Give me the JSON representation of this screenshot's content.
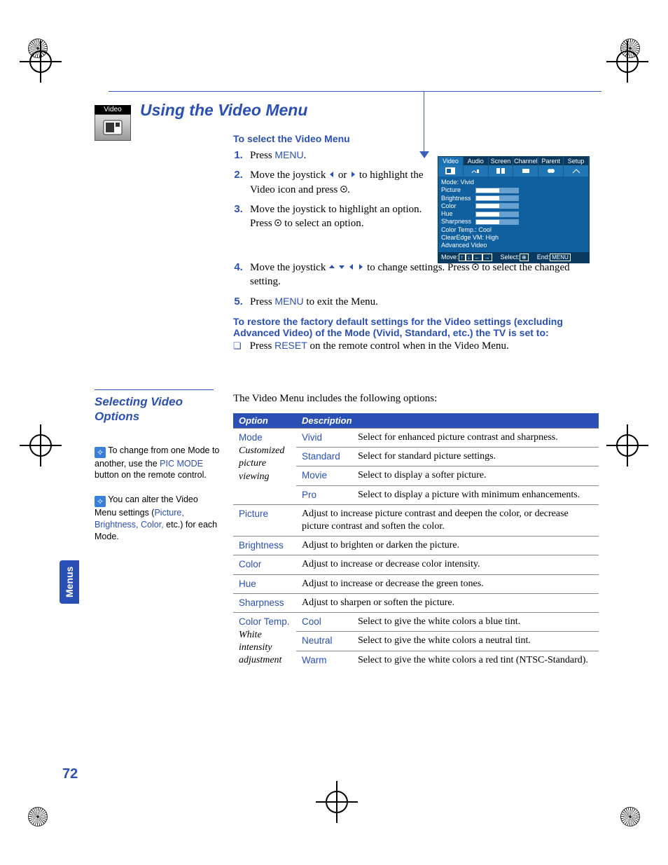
{
  "page_number": "72",
  "side_tab": "Menus",
  "icon_label": "Video",
  "title": "Using the Video Menu",
  "select_heading": "To select the Video Menu",
  "steps": {
    "s1a": "Press ",
    "s1b": "MENU",
    "s1c": ".",
    "s2a": "Move the joystick ",
    "s2b": " or ",
    "s2c": " to highlight the Video icon and press ",
    "s2d": ".",
    "s3a": "Move the joystick to highlight an option. Press ",
    "s3b": " to select an option.",
    "s4a": "Move the joystick ",
    "s4b": " to change settings. Press ",
    "s4c": " to select the changed setting.",
    "s5a": "Press ",
    "s5b": "MENU",
    "s5c": " to exit the Menu."
  },
  "restore_heading": "To restore the factory default settings for the Video settings (excluding Advanced Video) of the Mode (Vivid, Standard, etc.) the TV is set to:",
  "restore_a": "Press ",
  "restore_b": "RESET",
  "restore_c": " on the remote control when in the Video Menu.",
  "section2_title": "Selecting Video Options",
  "intro": "The Video Menu includes the following options:",
  "tips": {
    "t1a": " To change from one Mode to another, use the ",
    "t1b": "PIC MODE",
    "t1c": " button on the remote control.",
    "t2a": " You can alter the Video Menu settings (",
    "t2b": "Picture, Brightness, Color,",
    "t2c": " etc.) for each Mode."
  },
  "table": {
    "h1": "Option",
    "h2": "Description",
    "mode_label": "Mode",
    "mode_sub": "Customized picture viewing",
    "vivid": "Vivid",
    "vivid_d": "Select for enhanced picture contrast and sharpness.",
    "standard": "Standard",
    "standard_d": "Select for standard picture settings.",
    "movie": "Movie",
    "movie_d": "Select to display a softer picture.",
    "pro": "Pro",
    "pro_d": "Select to display a picture with minimum enhancements.",
    "picture": "Picture",
    "picture_d": "Adjust to increase picture contrast and deepen the color, or decrease picture contrast and soften the color.",
    "brightness": "Brightness",
    "brightness_d": "Adjust to brighten or darken the picture.",
    "color": "Color",
    "color_d": "Adjust to increase or decrease color intensity.",
    "hue": "Hue",
    "hue_d": "Adjust to increase or decrease the green tones.",
    "sharpness": "Sharpness",
    "sharpness_d": "Adjust to sharpen or soften the picture.",
    "colortemp": "Color Temp.",
    "colortemp_sub": "White intensity adjustment",
    "cool": "Cool",
    "cool_d": "Select to give the white colors a blue tint.",
    "neutral": "Neutral",
    "neutral_d": "Select to give the white colors a neutral tint.",
    "warm": "Warm",
    "warm_d": "Select to give the white colors a red tint (NTSC-Standard)."
  },
  "osd": {
    "tabs": [
      "Video",
      "Audio",
      "Screen",
      "Channel",
      "Parent",
      "Setup"
    ],
    "mode": "Mode: Vivid",
    "items": [
      "Picture",
      "Brightness",
      "Color",
      "Hue",
      "Sharpness"
    ],
    "ct": "Color Temp.: Cool",
    "cev": "ClearEdge VM: High",
    "adv": "Advanced Video",
    "move": "Move:",
    "select": "Select:",
    "end": "End:",
    "menu": "MENU"
  }
}
